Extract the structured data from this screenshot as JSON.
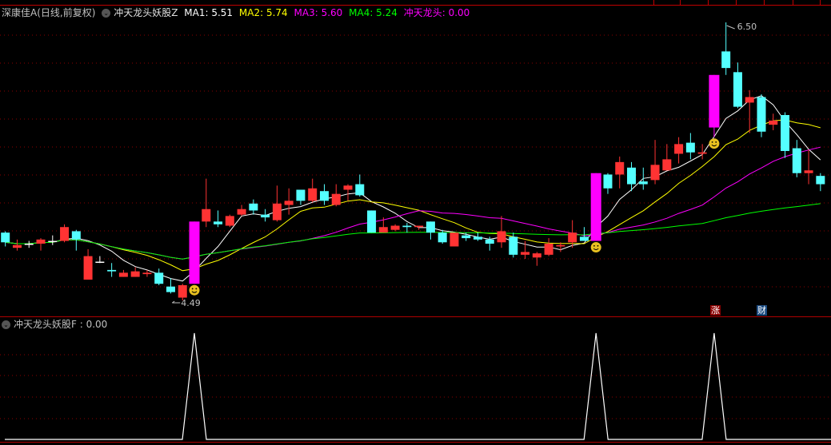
{
  "header": {
    "stock": "深康佳A",
    "period": "(日线,前复权)",
    "indicator": "冲天龙头妖股Z",
    "ma1": "MA1: 5.51",
    "ma2": "MA2: 5.74",
    "ma3": "MA3: 5.60",
    "ma4": "MA4: 5.24",
    "signal": "冲天龙头: 0.00"
  },
  "sub_header": {
    "indicator": "冲天龙头妖股F : 0.00"
  },
  "badges": {
    "zhang": "涨",
    "cai": "财"
  },
  "colors": {
    "up": "#ff3333",
    "down": "#54ffff",
    "signal": "#ff00ff",
    "ma1": "#ffffff",
    "ma2": "#ffff00",
    "ma3": "#ff00ff",
    "ma4": "#00ff00",
    "grid": "#8b0000"
  },
  "chart_data": [
    {
      "type": "candlestick",
      "title": "深康佳A (日线,前复权)",
      "ylim": [
        4.49,
        6.5
      ],
      "max_label": "6.50",
      "min_label": "4.49",
      "ma_periods": [
        5,
        10,
        20,
        60
      ],
      "signals": [
        16,
        50,
        60
      ],
      "ohlc": [
        [
          4.98,
          4.99,
          4.88,
          4.91
        ],
        [
          4.87,
          4.93,
          4.85,
          4.89
        ],
        [
          4.9,
          4.92,
          4.87,
          4.9
        ],
        [
          4.9,
          4.94,
          4.85,
          4.93
        ],
        [
          4.92,
          4.96,
          4.89,
          4.92
        ],
        [
          4.92,
          5.04,
          4.91,
          5.02
        ],
        [
          4.99,
          5.0,
          4.85,
          4.93
        ],
        [
          4.64,
          4.86,
          4.64,
          4.81
        ],
        [
          4.77,
          4.81,
          4.76,
          4.77
        ],
        [
          4.71,
          4.76,
          4.66,
          4.7
        ],
        [
          4.66,
          4.71,
          4.66,
          4.69
        ],
        [
          4.66,
          4.73,
          4.66,
          4.7
        ],
        [
          4.68,
          4.71,
          4.66,
          4.69
        ],
        [
          4.69,
          4.72,
          4.6,
          4.61
        ],
        [
          4.59,
          4.65,
          4.54,
          4.55
        ],
        [
          4.51,
          4.61,
          4.49,
          4.6
        ],
        [
          4.61,
          5.06,
          4.61,
          5.06
        ],
        [
          5.06,
          5.37,
          5.02,
          5.15
        ],
        [
          5.06,
          5.14,
          5.02,
          5.04
        ],
        [
          5.03,
          5.11,
          5.02,
          5.1
        ],
        [
          5.11,
          5.18,
          5.1,
          5.15
        ],
        [
          5.19,
          5.22,
          5.11,
          5.14
        ],
        [
          5.11,
          5.15,
          5.06,
          5.09
        ],
        [
          5.07,
          5.32,
          5.06,
          5.19
        ],
        [
          5.18,
          5.3,
          5.11,
          5.21
        ],
        [
          5.29,
          5.29,
          5.18,
          5.21
        ],
        [
          5.21,
          5.37,
          5.2,
          5.3
        ],
        [
          5.28,
          5.33,
          5.18,
          5.21
        ],
        [
          5.18,
          5.33,
          5.17,
          5.26
        ],
        [
          5.29,
          5.33,
          5.21,
          5.32
        ],
        [
          5.33,
          5.4,
          5.24,
          5.25
        ],
        [
          5.14,
          5.14,
          4.98,
          4.98
        ],
        [
          4.98,
          5.09,
          4.98,
          5.02
        ],
        [
          5.0,
          5.04,
          4.99,
          5.03
        ],
        [
          5.03,
          5.05,
          4.98,
          5.02
        ],
        [
          5.02,
          5.03,
          5.0,
          5.03
        ],
        [
          5.06,
          5.06,
          4.93,
          4.98
        ],
        [
          4.98,
          5.0,
          4.9,
          4.91
        ],
        [
          4.88,
          4.98,
          4.88,
          4.98
        ],
        [
          4.96,
          4.98,
          4.92,
          4.94
        ],
        [
          4.95,
          4.98,
          4.92,
          4.93
        ],
        [
          4.93,
          4.95,
          4.85,
          4.9
        ],
        [
          4.91,
          5.1,
          4.87,
          4.99
        ],
        [
          4.95,
          4.98,
          4.8,
          4.82
        ],
        [
          4.82,
          4.92,
          4.79,
          4.84
        ],
        [
          4.8,
          4.84,
          4.74,
          4.83
        ],
        [
          4.82,
          4.94,
          4.81,
          4.9
        ],
        [
          4.88,
          4.91,
          4.84,
          4.89
        ],
        [
          4.91,
          5.07,
          4.87,
          4.98
        ],
        [
          4.95,
          5.02,
          4.92,
          4.92
        ],
        [
          4.92,
          5.41,
          4.92,
          5.41
        ],
        [
          5.4,
          5.41,
          5.26,
          5.3
        ],
        [
          5.4,
          5.53,
          5.3,
          5.49
        ],
        [
          5.45,
          5.49,
          5.28,
          5.33
        ],
        [
          5.35,
          5.45,
          5.29,
          5.33
        ],
        [
          5.36,
          5.65,
          5.33,
          5.47
        ],
        [
          5.43,
          5.62,
          5.43,
          5.51
        ],
        [
          5.55,
          5.67,
          5.48,
          5.62
        ],
        [
          5.63,
          5.7,
          5.51,
          5.56
        ],
        [
          5.55,
          5.62,
          5.51,
          5.56
        ],
        [
          5.74,
          6.12,
          5.67,
          6.12
        ],
        [
          6.29,
          6.5,
          6.12,
          6.17
        ],
        [
          6.14,
          6.21,
          5.88,
          5.89
        ],
        [
          5.92,
          6.01,
          5.7,
          5.96
        ],
        [
          5.96,
          5.98,
          5.67,
          5.71
        ],
        [
          5.76,
          5.84,
          5.72,
          5.79
        ],
        [
          5.83,
          5.85,
          5.52,
          5.57
        ],
        [
          5.59,
          5.65,
          5.38,
          5.41
        ],
        [
          5.41,
          5.58,
          5.33,
          5.43
        ],
        [
          5.39,
          5.41,
          5.28,
          5.33
        ]
      ]
    },
    {
      "type": "line",
      "title": "冲天龙头妖股F",
      "ylim": [
        0,
        1
      ],
      "spikes_at": [
        16,
        50,
        60
      ],
      "baseline": 0
    }
  ]
}
